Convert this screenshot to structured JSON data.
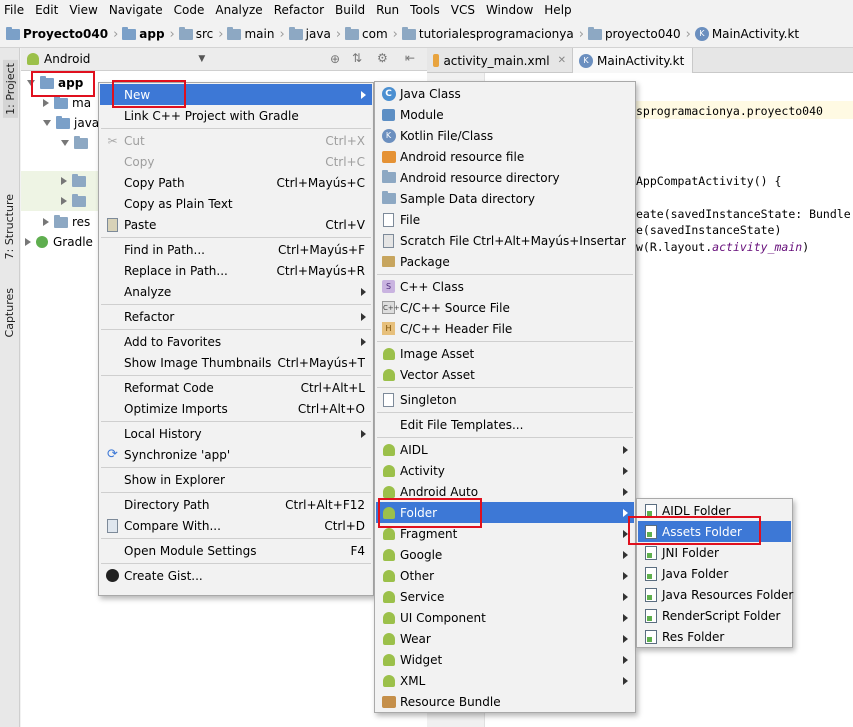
{
  "menubar": [
    "File",
    "Edit",
    "View",
    "Navigate",
    "Code",
    "Analyze",
    "Refactor",
    "Build",
    "Run",
    "Tools",
    "VCS",
    "Window",
    "Help"
  ],
  "breadcrumbs": [
    "Proyecto040",
    "app",
    "src",
    "main",
    "java",
    "com",
    "tutorialesprogramacionya",
    "proyecto040",
    "MainActivity.kt"
  ],
  "left_strip": {
    "project": "1: Project",
    "structure": "7: Structure",
    "captures": "Captures"
  },
  "project_panel": {
    "view": "Android",
    "tree": {
      "app": "app",
      "manifests": "ma",
      "java": "java",
      "res": "res",
      "gradle": "Gradle"
    }
  },
  "editor": {
    "tabs": [
      "activity_main.xml",
      "MainActivity.kt"
    ],
    "code_lines": [
      {
        "text": "sprogramacionya.proyecto040",
        "italic": ""
      },
      {
        "text": "AppCompatActivity() {",
        "italic": ""
      },
      {
        "text": "eate(savedInstanceState: Bundle",
        "italic": ""
      },
      {
        "text": "e(savedInstanceState)",
        "italic": ""
      },
      {
        "text": "w(R.layout.",
        "italic": "activity_main",
        "after": ")"
      }
    ]
  },
  "context_menu": [
    {
      "label": "New",
      "submenu": true,
      "selected": true
    },
    {
      "label": "Link C++ Project with Gradle"
    },
    {
      "sep": true
    },
    {
      "label": "Cut",
      "shortcut": "Ctrl+X",
      "disabled": true,
      "icon": "scissors-icon"
    },
    {
      "label": "Copy",
      "shortcut": "Ctrl+C",
      "disabled": true
    },
    {
      "label": "Copy Path",
      "shortcut": "Ctrl+Mayús+C"
    },
    {
      "label": "Copy as Plain Text"
    },
    {
      "label": "Paste",
      "shortcut": "Ctrl+V",
      "icon": "paste-icon"
    },
    {
      "sep": true
    },
    {
      "label": "Find in Path...",
      "shortcut": "Ctrl+Mayús+F"
    },
    {
      "label": "Replace in Path...",
      "shortcut": "Ctrl+Mayús+R"
    },
    {
      "label": "Analyze",
      "submenu": true
    },
    {
      "sep": true
    },
    {
      "label": "Refactor",
      "submenu": true
    },
    {
      "sep": true
    },
    {
      "label": "Add to Favorites",
      "submenu": true
    },
    {
      "label": "Show Image Thumbnails",
      "shortcut": "Ctrl+Mayús+T"
    },
    {
      "sep": true
    },
    {
      "label": "Reformat Code",
      "shortcut": "Ctrl+Alt+L"
    },
    {
      "label": "Optimize Imports",
      "shortcut": "Ctrl+Alt+O"
    },
    {
      "sep": true
    },
    {
      "label": "Local History",
      "submenu": true
    },
    {
      "label": "Synchronize 'app'",
      "icon": "sync-icon"
    },
    {
      "sep": true
    },
    {
      "label": "Show in Explorer"
    },
    {
      "sep": true
    },
    {
      "label": "Directory Path",
      "shortcut": "Ctrl+Alt+F12"
    },
    {
      "label": "Compare With...",
      "shortcut": "Ctrl+D",
      "icon": "compare-icon"
    },
    {
      "sep": true
    },
    {
      "label": "Open Module Settings",
      "shortcut": "F4"
    },
    {
      "sep": true
    },
    {
      "label": "Create Gist...",
      "icon": "github-icon"
    }
  ],
  "new_menu": [
    {
      "label": "Java Class",
      "icon": "java-class-icon"
    },
    {
      "label": "Module",
      "icon": "module-icon"
    },
    {
      "label": "Kotlin File/Class",
      "icon": "kotlin-icon"
    },
    {
      "label": "Android resource file",
      "icon": "resource-file-icon"
    },
    {
      "label": "Android resource directory",
      "icon": "resource-dir-icon"
    },
    {
      "label": "Sample Data directory",
      "icon": "folder-icon"
    },
    {
      "label": "File",
      "icon": "file-icon"
    },
    {
      "label": "Scratch File",
      "shortcut": "Ctrl+Alt+Mayús+Insertar",
      "icon": "scratch-icon"
    },
    {
      "label": "Package",
      "icon": "package-icon"
    },
    {
      "sep": true
    },
    {
      "label": "C++ Class",
      "icon": "cpp-class-icon"
    },
    {
      "label": "C/C++ Source File",
      "icon": "cpp-source-icon"
    },
    {
      "label": "C/C++ Header File",
      "icon": "cpp-header-icon"
    },
    {
      "sep": true
    },
    {
      "label": "Image Asset",
      "icon": "android-icon"
    },
    {
      "label": "Vector Asset",
      "icon": "android-icon"
    },
    {
      "sep": true
    },
    {
      "label": "Singleton",
      "icon": "singleton-icon"
    },
    {
      "sep": true
    },
    {
      "label": "Edit File Templates..."
    },
    {
      "sep": true
    },
    {
      "label": "AIDL",
      "submenu": true,
      "icon": "android-icon"
    },
    {
      "label": "Activity",
      "submenu": true,
      "icon": "android-icon"
    },
    {
      "label": "Android Auto",
      "submenu": true,
      "icon": "android-icon"
    },
    {
      "label": "Folder",
      "submenu": true,
      "selected": true,
      "icon": "android-icon"
    },
    {
      "label": "Fragment",
      "submenu": true,
      "icon": "android-icon"
    },
    {
      "label": "Google",
      "submenu": true,
      "icon": "android-icon"
    },
    {
      "label": "Other",
      "submenu": true,
      "icon": "android-icon"
    },
    {
      "label": "Service",
      "submenu": true,
      "icon": "android-icon"
    },
    {
      "label": "UI Component",
      "submenu": true,
      "icon": "android-icon"
    },
    {
      "label": "Wear",
      "submenu": true,
      "icon": "android-icon"
    },
    {
      "label": "Widget",
      "submenu": true,
      "icon": "android-icon"
    },
    {
      "label": "XML",
      "submenu": true,
      "icon": "android-icon"
    },
    {
      "label": "Resource Bundle",
      "icon": "resource-bundle-icon"
    }
  ],
  "folder_menu": [
    {
      "label": "AIDL Folder"
    },
    {
      "label": "Assets Folder",
      "selected": true
    },
    {
      "label": "JNI Folder"
    },
    {
      "label": "Java Folder"
    },
    {
      "label": "Java Resources Folder"
    },
    {
      "label": "RenderScript Folder"
    },
    {
      "label": "Res Folder"
    }
  ]
}
